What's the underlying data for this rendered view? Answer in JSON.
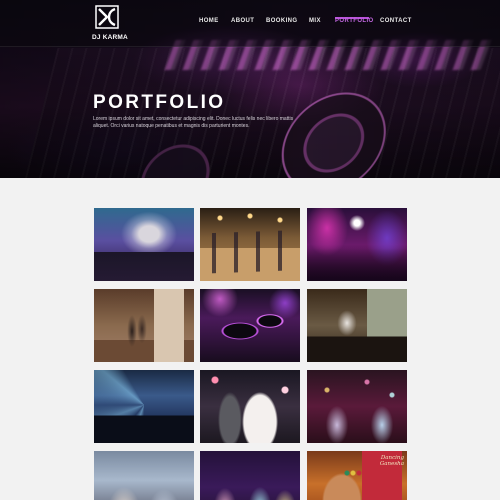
{
  "brand": {
    "name": "DJ KARMA",
    "accent": "#b84fd9"
  },
  "nav": {
    "items": [
      {
        "label": "HOME"
      },
      {
        "label": "ABOUT"
      },
      {
        "label": "BOOKING"
      },
      {
        "label": "MIX"
      },
      {
        "label": "PORTFOLIO",
        "active": true
      },
      {
        "label": "CONTACT"
      }
    ]
  },
  "hero": {
    "title": "PORTFOLIO",
    "subtitle": "Lorem ipsum dolor sit amet, consectetur adipiscing elit. Donec luctus felis nec libero mattis aliquet. Orci varius natoque penatibus et magnis dis parturient montes."
  },
  "gallery": {
    "tiles": [
      {
        "icon": "dj-booth-smoke-photo"
      },
      {
        "icon": "dance-floor-string-lights-photo"
      },
      {
        "icon": "nightclub-crowd-photo"
      },
      {
        "icon": "ballroom-couple-dance-photo"
      },
      {
        "icon": "dj-turntables-closeup-photo"
      },
      {
        "icon": "dj-at-mixer-photo"
      },
      {
        "icon": "concert-stage-lights-photo"
      },
      {
        "icon": "wedding-couple-confetti-photo"
      },
      {
        "icon": "party-guests-celebrating-photo"
      },
      {
        "icon": "crowd-dancing-photo"
      },
      {
        "icon": "party-guests-night-photo"
      },
      {
        "icon": "dancer-poster-photo",
        "label": "Dancing Ganesha"
      }
    ]
  }
}
